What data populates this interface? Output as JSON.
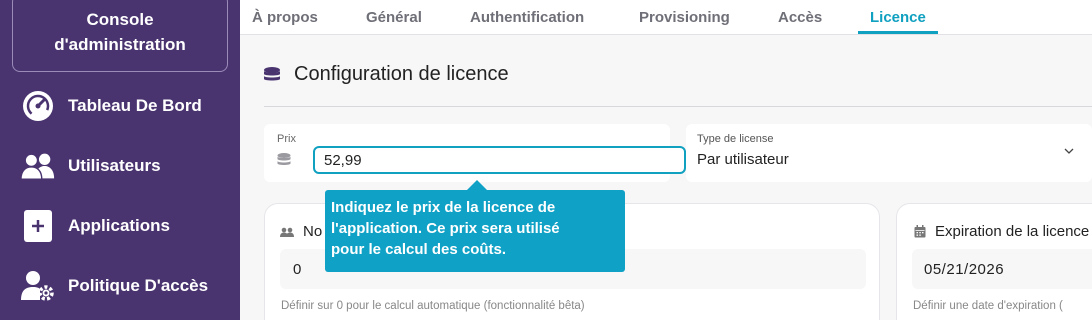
{
  "sidebar": {
    "console_line1": "Console",
    "console_line2": "d'administration",
    "items": [
      {
        "label": "Tableau De Bord",
        "icon": "dashboard-gauge-icon"
      },
      {
        "label": "Utilisateurs",
        "icon": "users-icon"
      },
      {
        "label": "Applications",
        "icon": "add-application-icon"
      },
      {
        "label": "Politique D'accès",
        "icon": "user-gear-icon"
      }
    ],
    "bg_color": "#4a3470"
  },
  "tabs": [
    {
      "label": "À propos",
      "active": false
    },
    {
      "label": "Général",
      "active": false
    },
    {
      "label": "Authentification",
      "active": false
    },
    {
      "label": "Provisioning",
      "active": false
    },
    {
      "label": "Accès",
      "active": false
    },
    {
      "label": "Licence",
      "active": true
    }
  ],
  "section": {
    "title": "Configuration de licence",
    "icon": "coins-icon"
  },
  "prix": {
    "label": "Prix",
    "value": "52,99",
    "icon": "coins-icon"
  },
  "type_license": {
    "label": "Type de license",
    "value": "Par utilisateur"
  },
  "nombre": {
    "title": "No",
    "value": "0",
    "help": "Définir sur 0 pour le calcul automatique (fonctionnalité bêta)",
    "icon": "users-icon"
  },
  "expiration": {
    "title": "Expiration de la licence",
    "value": "05/21/2026",
    "help": "Définir une date d'expiration (",
    "icon": "calendar-icon"
  },
  "tooltip": {
    "text_line1": "Indiquez le prix de la licence de",
    "text_line2": "l'application. Ce prix sera utilisé",
    "text_line3": "pour le calcul des coûts."
  },
  "colors": {
    "accent": "#10a0c0",
    "tooltip_bg": "#10a2c6"
  }
}
